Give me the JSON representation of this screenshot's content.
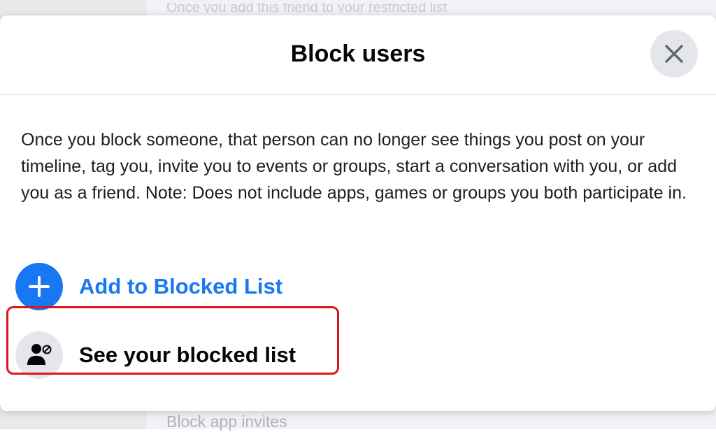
{
  "background": {
    "top_text": "Once you add this friend to your restricted list",
    "bottom_text": "Block app invites"
  },
  "dialog": {
    "title": "Block users",
    "close_icon": "close-icon",
    "description": "Once you block someone, that person can no longer see things you post on your timeline, tag you, invite you to events or groups, start a conversation with you, or add you as a friend. Note: Does not include apps, games or groups you both participate in.",
    "actions": [
      {
        "label": "Add to Blocked List",
        "icon": "plus-icon",
        "color": "#1877f2"
      },
      {
        "label": "See your blocked list",
        "icon": "blocked-user-icon",
        "color": "#050505"
      }
    ],
    "highlight_color": "#d9161e"
  }
}
